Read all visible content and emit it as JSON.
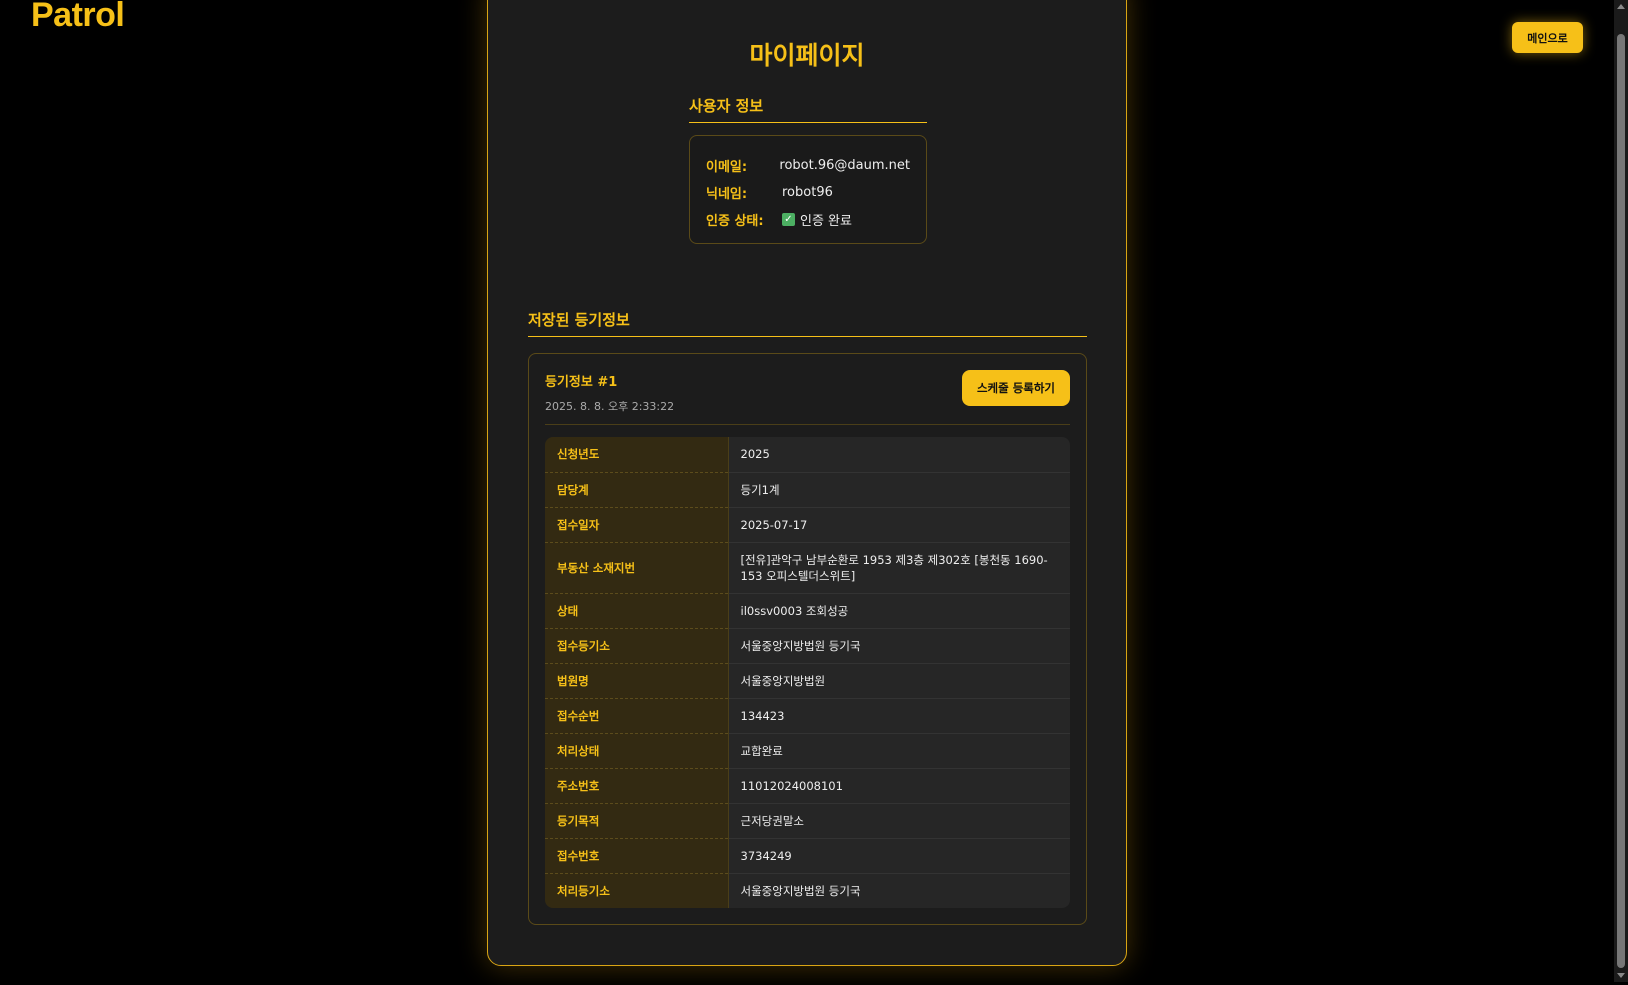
{
  "header": {
    "logo": "Patrol",
    "main_button": "메인으로"
  },
  "page": {
    "title": "마이페이지"
  },
  "user_info": {
    "title": "사용자 정보",
    "email_label": "이메일:",
    "email": "robot.96@daum.net",
    "nickname_label": "닉네임:",
    "nickname": "robot96",
    "status_label": "인증 상태:",
    "status": "인증 완료",
    "status_icon": "check-icon"
  },
  "saved": {
    "title": "저장된 등기정보",
    "item_title": "등기정보 #1",
    "item_date": "2025. 8. 8. 오후 2:33:22",
    "schedule_button": "스케줄 등록하기",
    "rows": [
      {
        "key": "신청년도",
        "value": "2025"
      },
      {
        "key": "담당계",
        "value": "등기1계"
      },
      {
        "key": "접수일자",
        "value": "2025-07-17"
      },
      {
        "key": "부동산 소재지번",
        "value": "[전유]관악구 남부순환로 1953 제3층 제302호 [봉천동 1690-153 오피스텔더스위트]"
      },
      {
        "key": "상태",
        "value": "il0ssv0003 조회성공"
      },
      {
        "key": "접수등기소",
        "value": "서울중앙지방법원 등기국"
      },
      {
        "key": "법원명",
        "value": "서울중앙지방법원"
      },
      {
        "key": "접수순번",
        "value": "134423"
      },
      {
        "key": "처리상태",
        "value": "교합완료"
      },
      {
        "key": "주소번호",
        "value": "11012024008101"
      },
      {
        "key": "등기목적",
        "value": "근저당권말소"
      },
      {
        "key": "접수번호",
        "value": "3734249"
      },
      {
        "key": "처리등기소",
        "value": "서울중앙지방법원 등기국"
      }
    ]
  },
  "colors": {
    "accent": "#f6c018",
    "background": "#000000",
    "card": "#1c1c1c",
    "verified": "#5cc27a"
  }
}
